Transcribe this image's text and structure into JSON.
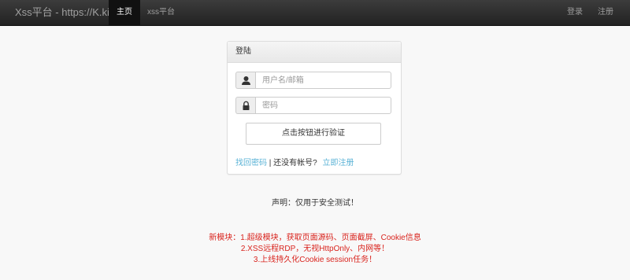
{
  "navbar": {
    "brand": "Xss平台 - https://K.ki",
    "tabs": [
      {
        "label": "主页",
        "active": true
      },
      {
        "label": "xss平台",
        "active": false
      }
    ],
    "right": {
      "login": "登录",
      "register": "注册"
    }
  },
  "login_panel": {
    "heading": "登陆",
    "username": {
      "placeholder": "用户名/邮箱",
      "value": "",
      "icon": "user-icon"
    },
    "password": {
      "placeholder": "密码",
      "value": "",
      "icon": "lock-icon"
    },
    "verify_button": "点击按钮进行验证",
    "forgot_link": "找回密码",
    "separator": "|",
    "no_account_text": "还没有帐号?",
    "register_link": "立即注册"
  },
  "statement": "声明：仅用于安全测试！",
  "notice": {
    "color": "#d9231d",
    "lines": [
      "新模块：1.超级模块，获取页面源码、页面截屏、Cookie信息",
      "2.XSS远程RDP，无视HttpOnly、内网等！",
      "3.上线持久化Cookie session任务！"
    ]
  }
}
